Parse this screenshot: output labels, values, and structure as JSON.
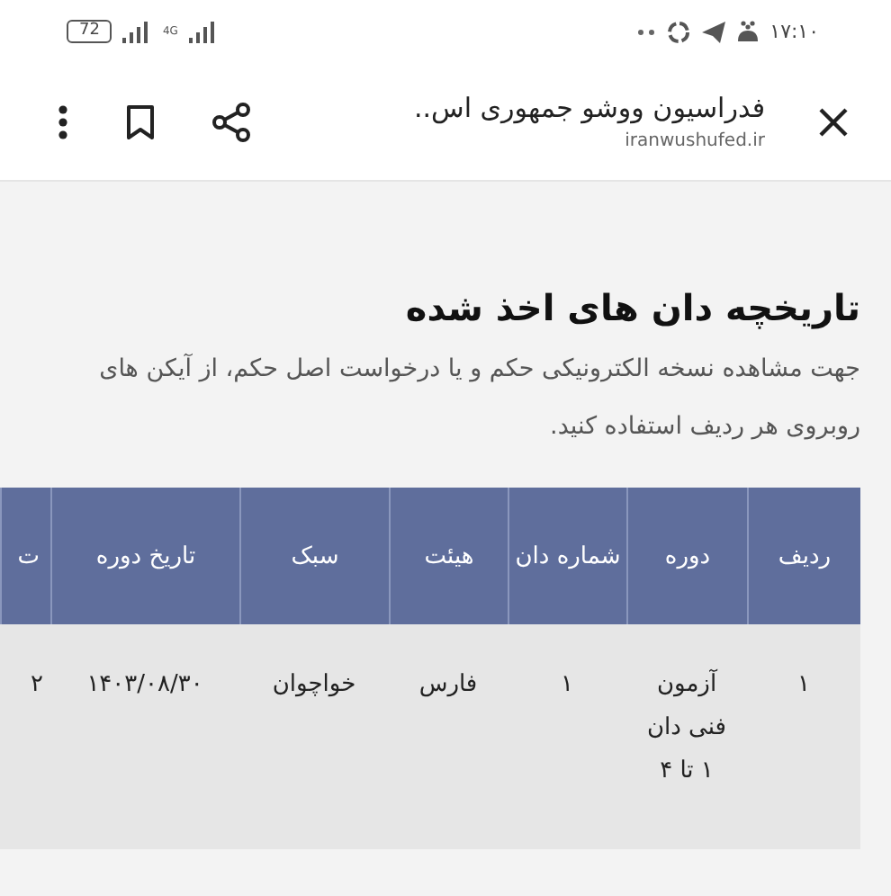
{
  "status_bar": {
    "battery": "72",
    "network": "4G",
    "time": "۱۷:۱۰"
  },
  "toolbar": {
    "title": "فدراسیون ووشو جمهوری اس..",
    "url": "iranwushufed.ir"
  },
  "heading": "تاریخچه دان های اخذ شده",
  "description": "جهت مشاهده نسخه الکترونیکی حکم و یا درخواست اصل حکم، از آیکن های روبروی هر ردیف استفاده کنید.",
  "table": {
    "columns": [
      "ردیف",
      "دوره",
      "شماره دان",
      "هیئت",
      "سبک",
      "تاریخ دوره",
      "ت"
    ],
    "rows": [
      [
        "۱",
        "آزمون فنی دان ۱ تا ۴",
        "۱",
        "فارس",
        "خواچوان",
        "۱۴۰۳/۰۸/۳۰",
        "۲"
      ]
    ]
  }
}
